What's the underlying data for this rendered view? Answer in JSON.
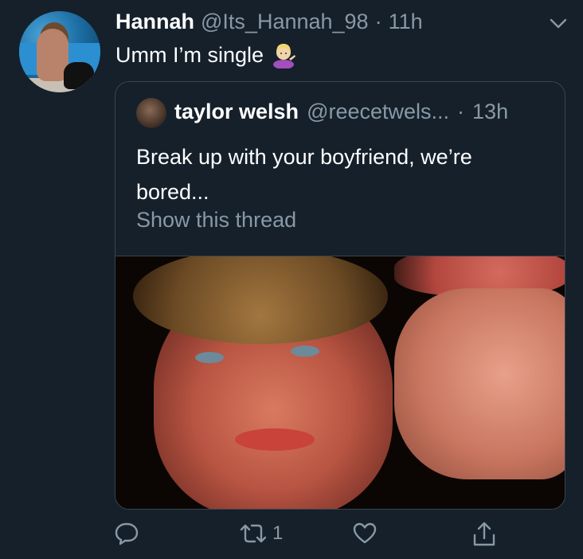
{
  "tweet": {
    "author_name": "Hannah",
    "author_handle": "@Its_Hannah_98",
    "separator": "·",
    "time": "11h",
    "text": "Umm I’m single",
    "emoji": "information-desk-person-emoji"
  },
  "quote": {
    "author_name": "taylor welsh",
    "author_handle": "@reecetwels...",
    "separator": "·",
    "time": "13h",
    "text": "Break up with your boyfriend, we’re bored...",
    "show_thread": "Show this thread"
  },
  "actions": {
    "reply_icon": "reply-icon",
    "retweet_icon": "retweet-icon",
    "retweet_count": "1",
    "like_icon": "heart-icon",
    "share_icon": "share-icon"
  },
  "colors": {
    "background": "#15202b",
    "secondary_text": "#8899a6",
    "border": "#38444d"
  }
}
